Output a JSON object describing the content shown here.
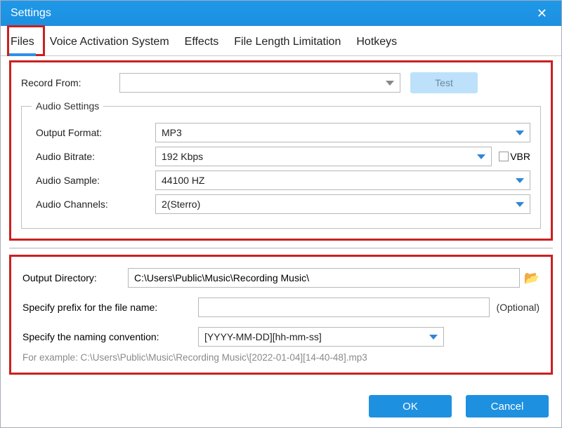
{
  "window": {
    "title": "Settings"
  },
  "tabs": {
    "files": "Files",
    "vas": "Voice Activation System",
    "effects": "Effects",
    "fll": "File Length Limitation",
    "hotkeys": "Hotkeys"
  },
  "record": {
    "label": "Record  From:",
    "value": "",
    "test_label": "Test"
  },
  "audio": {
    "legend": "Audio Settings",
    "output_format_label": "Output Format:",
    "output_format_value": "MP3",
    "bitrate_label": "Audio Bitrate:",
    "bitrate_value": "192 Kbps",
    "vbr_label": "VBR",
    "sample_label": "Audio Sample:",
    "sample_value": "44100 HZ",
    "channels_label": "Audio Channels:",
    "channels_value": "2(Sterro)"
  },
  "output": {
    "dir_label": "Output Directory:",
    "dir_value": "C:\\Users\\Public\\Music\\Recording Music\\",
    "prefix_label": "Specify prefix for the file name:",
    "prefix_value": "",
    "optional": "(Optional)",
    "naming_label": "Specify the naming convention:",
    "naming_value": "[YYYY-MM-DD][hh-mm-ss]",
    "example": "For example: C:\\Users\\Public\\Music\\Recording Music\\[2022-01-04][14-40-48].mp3"
  },
  "buttons": {
    "ok": "OK",
    "cancel": "Cancel"
  }
}
